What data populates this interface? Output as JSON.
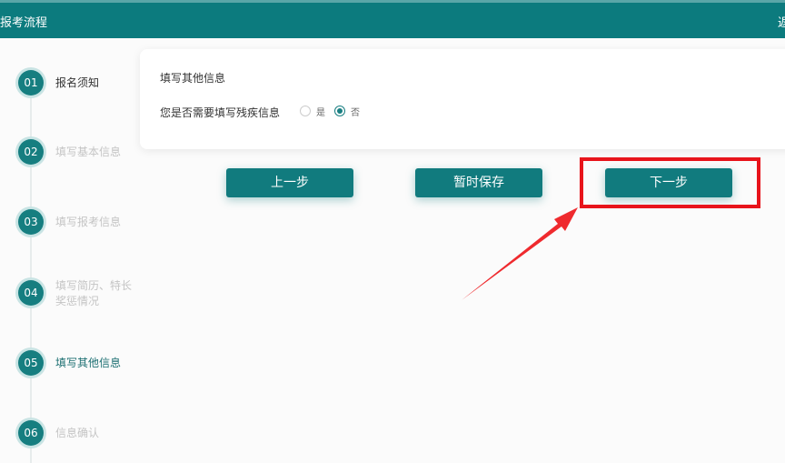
{
  "header": {
    "title": "报考流程",
    "back_label": "返回"
  },
  "steps": [
    {
      "number": "01",
      "label": "报名须知"
    },
    {
      "number": "02",
      "label": "填写基本信息"
    },
    {
      "number": "03",
      "label": "填写报考信息"
    },
    {
      "number": "04",
      "label": "填写简历、特长 奖惩情况"
    },
    {
      "number": "05",
      "label": "填写其他信息"
    },
    {
      "number": "06",
      "label": "信息确认"
    }
  ],
  "form": {
    "section_title": "填写其他信息",
    "question": "您是否需要填写残疾信息",
    "options": [
      {
        "label": "是",
        "checked": false
      },
      {
        "label": "否",
        "checked": true
      }
    ]
  },
  "actions": {
    "prev_label": "上一步",
    "save_label": "暂时保存",
    "next_label": "下一步"
  },
  "colors": {
    "primary": "#117b7e",
    "highlight": "#e8141b"
  }
}
